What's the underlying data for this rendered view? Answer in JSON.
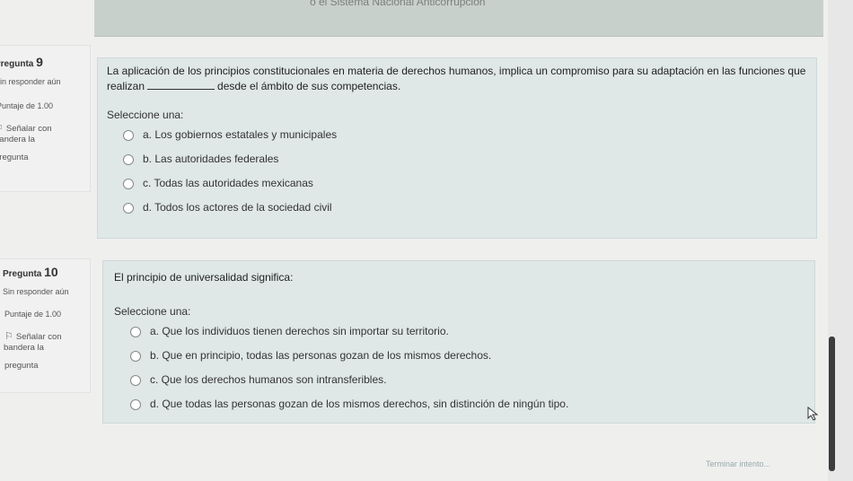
{
  "header": {
    "title_partial": "o el Sistema Nacional Anticorrupción"
  },
  "questions": [
    {
      "number_label": "Pregunta",
      "number": "9",
      "status": "Sin responder aún",
      "score": "Puntaje de 1.00",
      "flag_line1": "Señalar con",
      "flag_line2": "bandera la",
      "flag_line3": "pregunta",
      "text_before": "La aplicación de los principios constitucionales en materia de derechos humanos, implica un compromiso para su adaptación en las funciones que realizan",
      "text_after": "desde el ámbito de sus competencias.",
      "select_label": "Seleccione una:",
      "options": [
        "a. Los gobiernos estatales y municipales",
        "b. Las autoridades federales",
        "c. Todas las autoridades mexicanas",
        "d. Todos los actores de la sociedad civil"
      ]
    },
    {
      "number_label": "Pregunta",
      "number": "10",
      "status": "Sin responder aún",
      "score": "Puntaje de 1.00",
      "flag_line1": "Señalar con",
      "flag_line2": "bandera la",
      "flag_line3": "pregunta",
      "text": "El principio de universalidad significa:",
      "select_label": "Seleccione una:",
      "options": [
        "a. Que los individuos tienen derechos sin importar su territorio.",
        "b. Que en principio, todas las personas gozan de los mismos derechos.",
        "c. Que los derechos humanos son intransferibles.",
        "d. Que todas las personas gozan de los mismos derechos, sin distinción de ningún tipo."
      ]
    }
  ],
  "footer": {
    "finish_label": "Terminar intento..."
  }
}
